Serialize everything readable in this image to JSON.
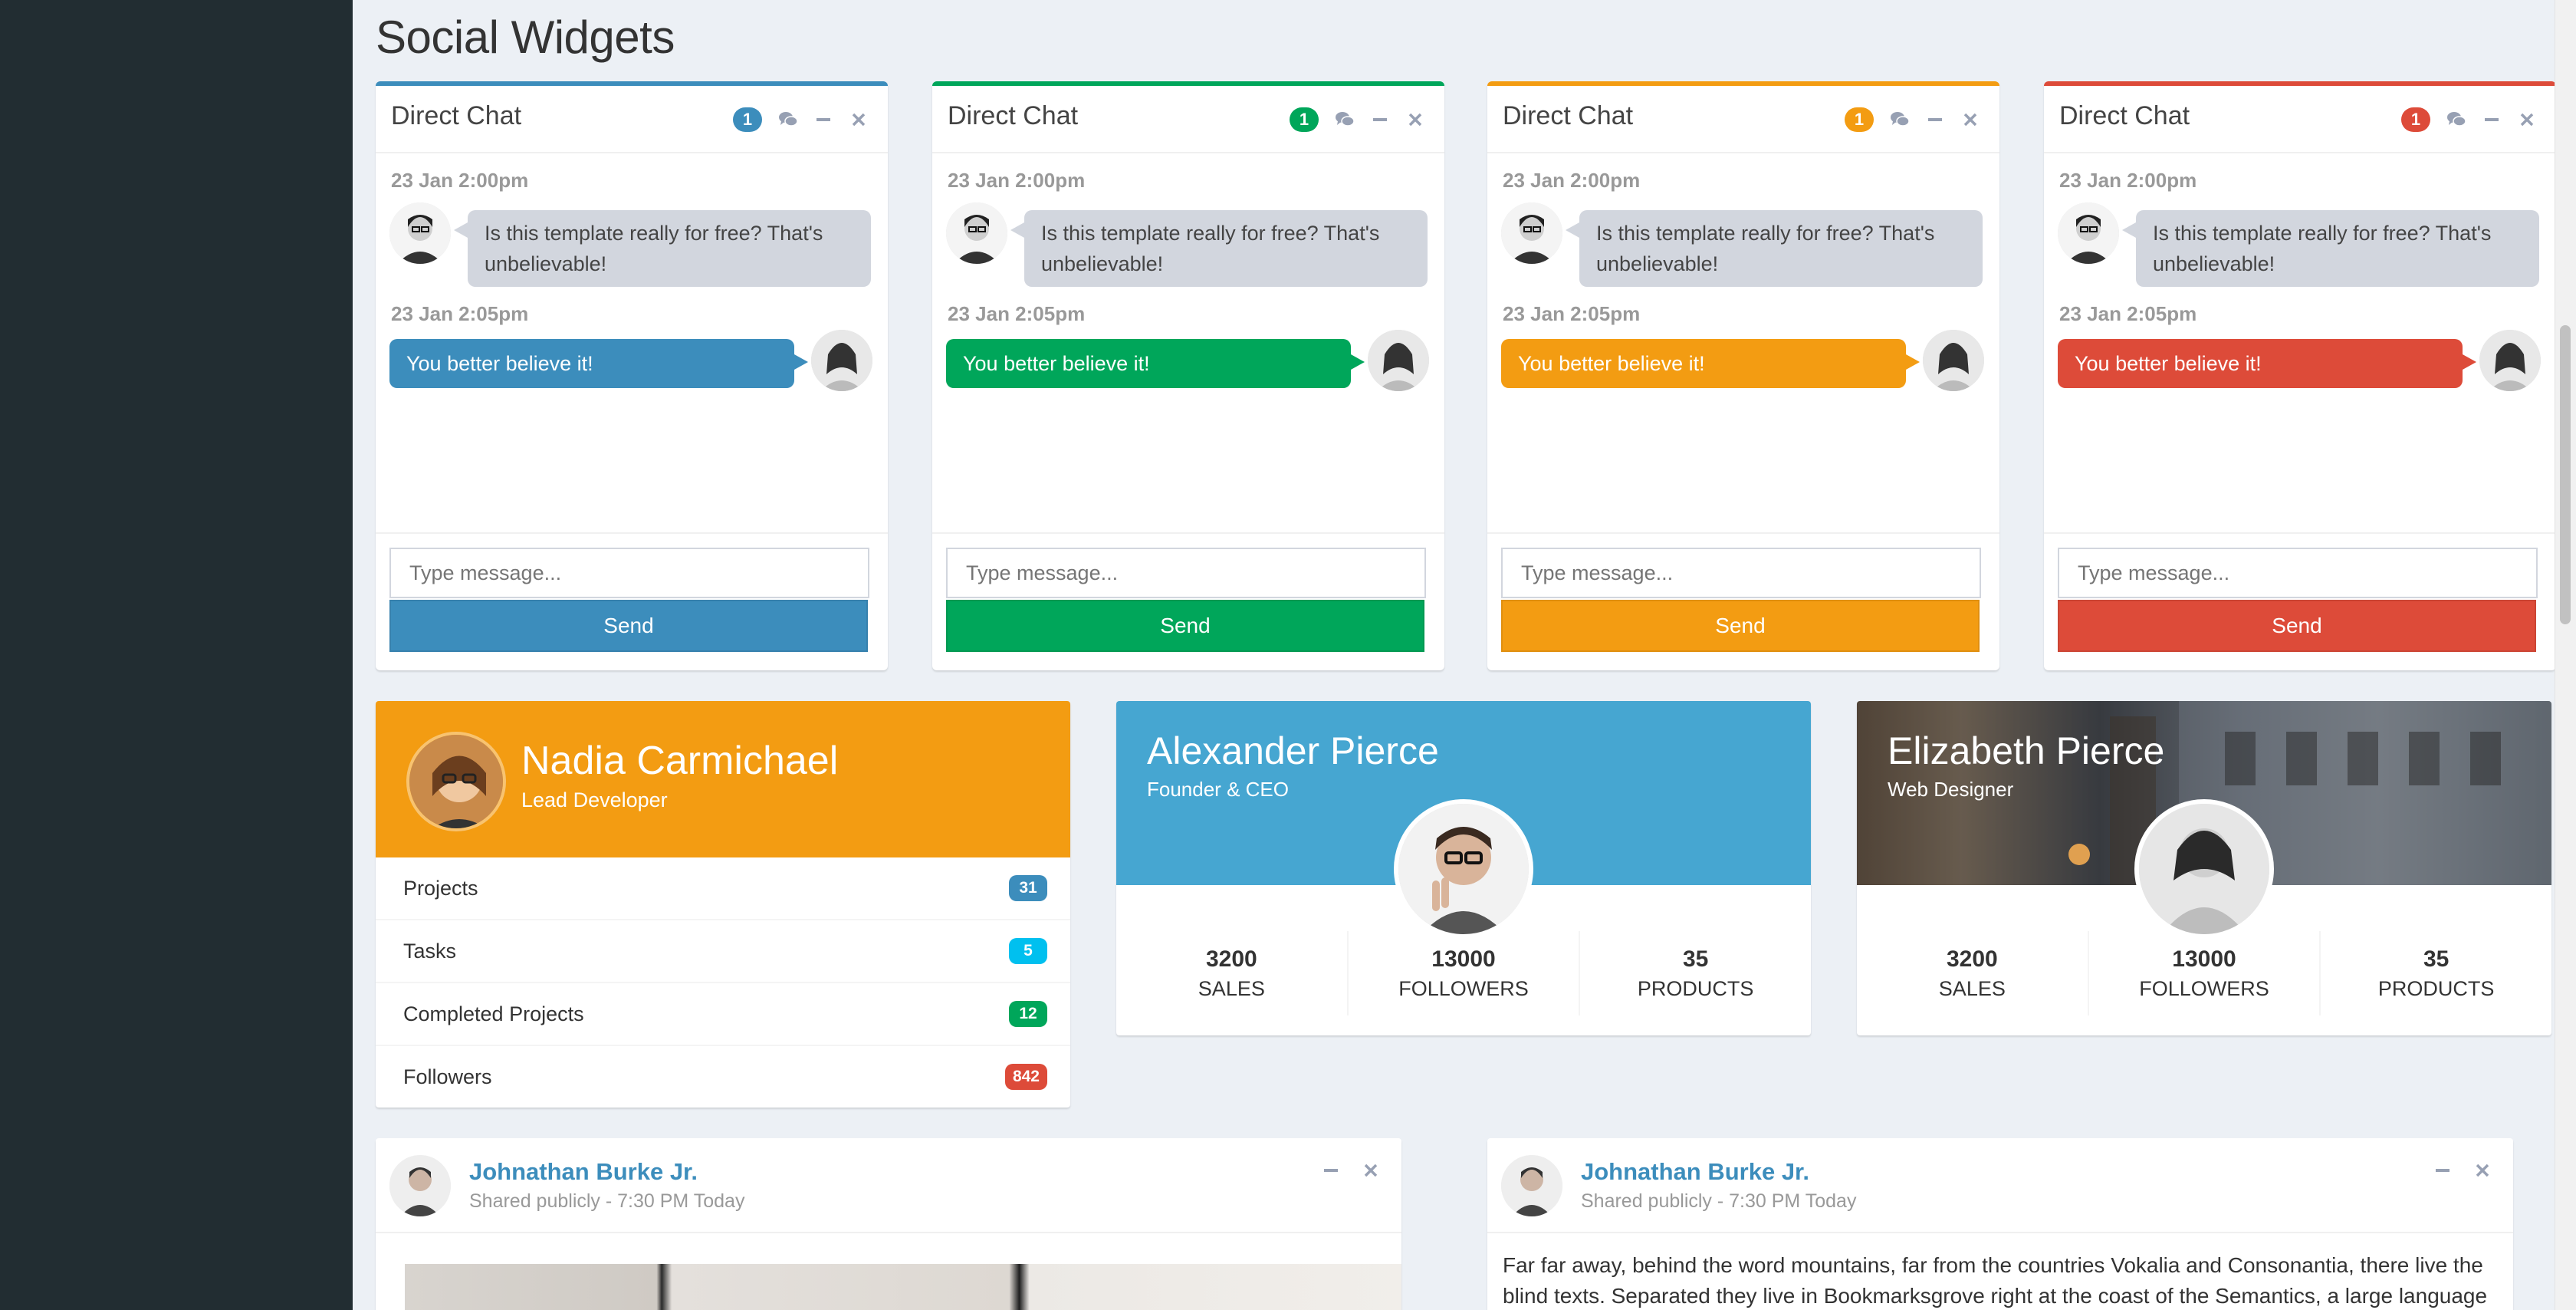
{
  "page": {
    "title": "Social Widgets"
  },
  "colors": {
    "primary": "#3c8dbc",
    "success": "#00a65a",
    "warning": "#f39c12",
    "danger": "#dd4b39",
    "info": "#00c0ef"
  },
  "chats": [
    {
      "title": "Direct Chat",
      "badge": "1",
      "color": "#3c8dbc",
      "messages": [
        {
          "time": "23 Jan 2:00pm",
          "text": "Is this template really for free? That's unbelievable!"
        },
        {
          "time": "23 Jan 2:05pm",
          "text": "You better believe it!"
        }
      ],
      "placeholder": "Type message...",
      "send": "Send"
    },
    {
      "title": "Direct Chat",
      "badge": "1",
      "color": "#00a65a",
      "messages": [
        {
          "time": "23 Jan 2:00pm",
          "text": "Is this template really for free? That's unbelievable!"
        },
        {
          "time": "23 Jan 2:05pm",
          "text": "You better believe it!"
        }
      ],
      "placeholder": "Type message...",
      "send": "Send"
    },
    {
      "title": "Direct Chat",
      "badge": "1",
      "color": "#f39c12",
      "messages": [
        {
          "time": "23 Jan 2:00pm",
          "text": "Is this template really for free? That's unbelievable!"
        },
        {
          "time": "23 Jan 2:05pm",
          "text": "You better believe it!"
        }
      ],
      "placeholder": "Type message...",
      "send": "Send"
    },
    {
      "title": "Direct Chat",
      "badge": "1",
      "color": "#dd4b39",
      "messages": [
        {
          "time": "23 Jan 2:00pm",
          "text": "Is this template really for free? That's unbelievable!"
        },
        {
          "time": "23 Jan 2:05pm",
          "text": "You better believe it!"
        }
      ],
      "placeholder": "Type message...",
      "send": "Send"
    }
  ],
  "widget_nadia": {
    "name": "Nadia Carmichael",
    "desc": "Lead Developer",
    "items": [
      {
        "label": "Projects",
        "count": "31",
        "color": "#3c8dbc"
      },
      {
        "label": "Tasks",
        "count": "5",
        "color": "#00c0ef"
      },
      {
        "label": "Completed Projects",
        "count": "12",
        "color": "#00a65a"
      },
      {
        "label": "Followers",
        "count": "842",
        "color": "#dd4b39"
      }
    ]
  },
  "widget_alexander": {
    "name": "Alexander Pierce",
    "desc": "Founder & CEO",
    "stats": [
      {
        "num": "3200",
        "label": "SALES"
      },
      {
        "num": "13000",
        "label": "FOLLOWERS"
      },
      {
        "num": "35",
        "label": "PRODUCTS"
      }
    ]
  },
  "widget_elizabeth": {
    "name": "Elizabeth Pierce",
    "desc": "Web Designer",
    "stats": [
      {
        "num": "3200",
        "label": "SALES"
      },
      {
        "num": "13000",
        "label": "FOLLOWERS"
      },
      {
        "num": "35",
        "label": "PRODUCTS"
      }
    ]
  },
  "posts": [
    {
      "user": "Johnathan Burke Jr.",
      "meta": "Shared publicly - 7:30 PM Today"
    },
    {
      "user": "Johnathan Burke Jr.",
      "meta": "Shared publicly - 7:30 PM Today",
      "text": "Far far away, behind the word mountains, far from the countries Vokalia and Consonantia, there live the blind texts. Separated they live in Bookmarksgrove right at the coast of the Semantics, a large language ocean. A small river"
    }
  ]
}
